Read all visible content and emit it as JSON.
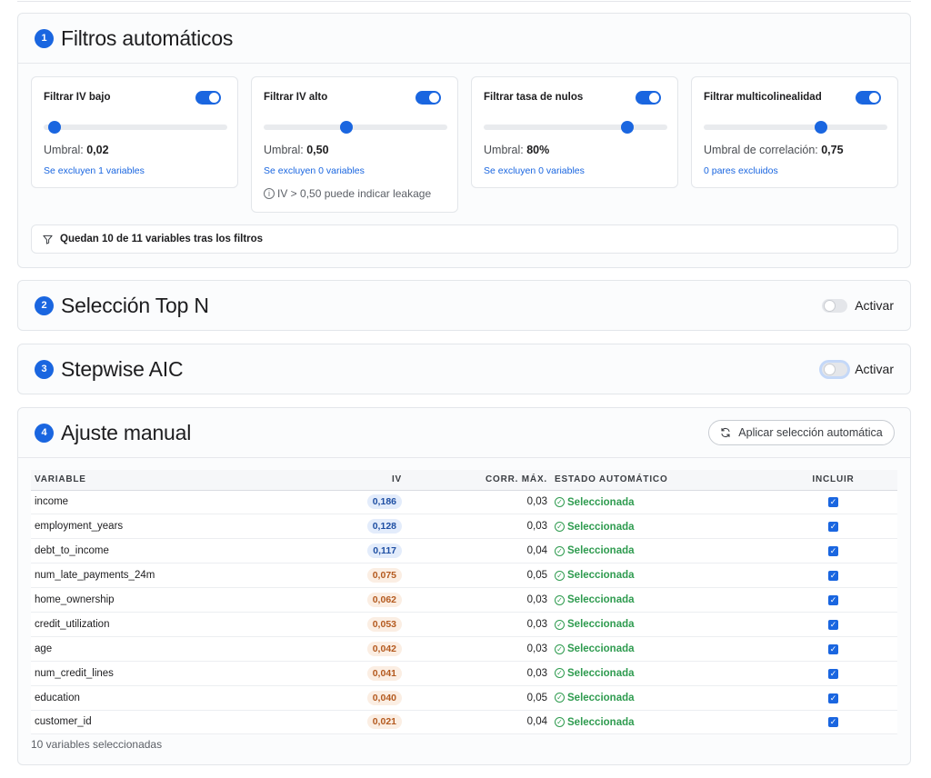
{
  "filters": {
    "number": "1",
    "title": "Filtros automáticos",
    "boxes": [
      {
        "title": "Filtrar IV bajo",
        "enabled": true,
        "slider_fraction": 0.06,
        "umbral_label": "Umbral: ",
        "umbral_value": "0,02",
        "excluded_text": "Se excluyen 1 variables"
      },
      {
        "title": "Filtrar IV alto",
        "enabled": true,
        "slider_fraction": 0.45,
        "umbral_label": "Umbral: ",
        "umbral_value": "0,50",
        "excluded_text": "Se excluyen 0 variables",
        "warning": "IV > 0,50 puede indicar leakage"
      },
      {
        "title": "Filtrar tasa de nulos",
        "enabled": true,
        "slider_fraction": 0.78,
        "umbral_label": "Umbral: ",
        "umbral_value": "80%",
        "excluded_text": "Se excluyen 0 variables"
      },
      {
        "title": "Filtrar multicolinealidad",
        "enabled": true,
        "slider_fraction": 0.64,
        "umbral_label": "Umbral de correlación: ",
        "umbral_value": "0,75",
        "excluded_text": "0 pares excluidos"
      }
    ],
    "summary": "Quedan 10 de 11 variables tras los filtros"
  },
  "topn": {
    "number": "2",
    "title": "Selección Top N",
    "toggle_label": "Activar",
    "enabled": false
  },
  "stepwise": {
    "number": "3",
    "title": "Stepwise AIC",
    "toggle_label": "Activar",
    "enabled": false
  },
  "manual": {
    "number": "4",
    "title": "Ajuste manual",
    "apply_button": "Aplicar selección automática",
    "columns": {
      "variable": "VARIABLE",
      "iv": "IV",
      "corr": "CORR. MÁX.",
      "estado": "ESTADO AUTOMÁTICO",
      "incluir": "INCLUIR"
    },
    "rows": [
      {
        "variable": "income",
        "iv": "0,186",
        "iv_tone": "blue",
        "corr": "0,03",
        "estado": "Seleccionada",
        "incluir": true
      },
      {
        "variable": "employment_years",
        "iv": "0,128",
        "iv_tone": "blue",
        "corr": "0,03",
        "estado": "Seleccionada",
        "incluir": true
      },
      {
        "variable": "debt_to_income",
        "iv": "0,117",
        "iv_tone": "blue",
        "corr": "0,04",
        "estado": "Seleccionada",
        "incluir": true
      },
      {
        "variable": "num_late_payments_24m",
        "iv": "0,075",
        "iv_tone": "orange",
        "corr": "0,05",
        "estado": "Seleccionada",
        "incluir": true
      },
      {
        "variable": "home_ownership",
        "iv": "0,062",
        "iv_tone": "orange",
        "corr": "0,03",
        "estado": "Seleccionada",
        "incluir": true
      },
      {
        "variable": "credit_utilization",
        "iv": "0,053",
        "iv_tone": "orange",
        "corr": "0,03",
        "estado": "Seleccionada",
        "incluir": true
      },
      {
        "variable": "age",
        "iv": "0,042",
        "iv_tone": "orange",
        "corr": "0,03",
        "estado": "Seleccionada",
        "incluir": true
      },
      {
        "variable": "num_credit_lines",
        "iv": "0,041",
        "iv_tone": "orange",
        "corr": "0,03",
        "estado": "Seleccionada",
        "incluir": true
      },
      {
        "variable": "education",
        "iv": "0,040",
        "iv_tone": "orange",
        "corr": "0,05",
        "estado": "Seleccionada",
        "incluir": true
      },
      {
        "variable": "customer_id",
        "iv": "0,021",
        "iv_tone": "orange",
        "corr": "0,04",
        "estado": "Seleccionada",
        "incluir": true
      }
    ],
    "footnote": "10 variables seleccionadas"
  },
  "colors": {
    "accent": "#1a66e0",
    "success": "#2e9b4f",
    "iv_high": "#1f4fa3",
    "iv_low": "#b45a1f"
  }
}
